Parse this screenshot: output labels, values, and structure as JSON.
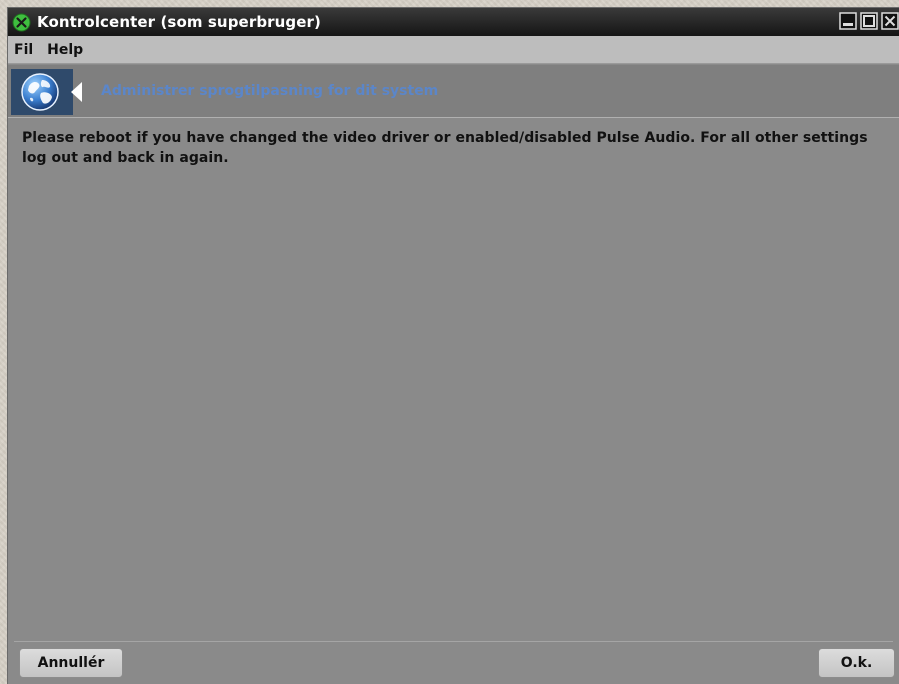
{
  "window": {
    "title": "Kontrolcenter (som superbruger)"
  },
  "menubar": {
    "items": [
      {
        "label": "Fil"
      },
      {
        "label": "Help"
      }
    ]
  },
  "banner": {
    "icon": "globe-icon",
    "title": "Administrer sprogtilpasning for dit system"
  },
  "content": {
    "message": "Please reboot if you have changed the video driver or enabled/disabled Pulse Audio. For all other settings log out and back in again."
  },
  "buttons": {
    "cancel_label": "Annullér",
    "ok_label": "O.k."
  },
  "colors": {
    "titlebar": "#151515",
    "window_body": "#8a8a8a",
    "menubar": "#bdbdbd",
    "banner_title": "#5b86c9",
    "banner_icon_bg": "#2f4a6b",
    "app_icon": "#3fbf3f"
  }
}
